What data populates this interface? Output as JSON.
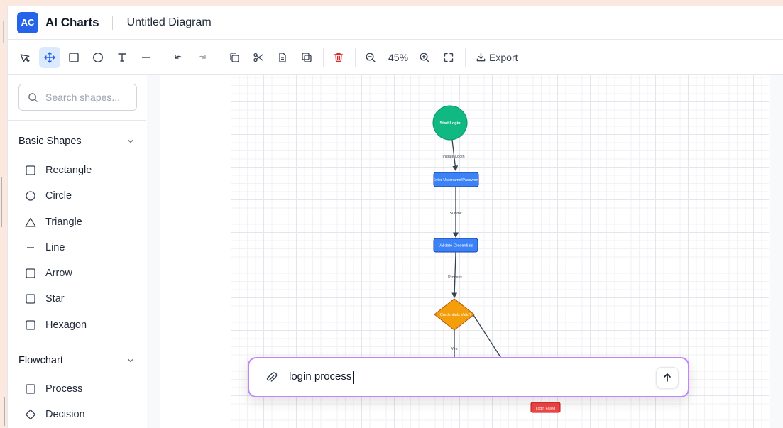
{
  "header": {
    "logo_text": "AC",
    "app_name": "AI Charts",
    "diagram_title": "Untitled Diagram"
  },
  "toolbar": {
    "tools": [
      "select-icon",
      "move-icon",
      "rectangle-icon",
      "circle-icon",
      "text-icon",
      "line-icon"
    ],
    "active_tool": "move",
    "zoom_level": "45%",
    "export_label": "Export"
  },
  "sidebar": {
    "search_placeholder": "Search shapes...",
    "sections": [
      {
        "title": "Basic Shapes",
        "items": [
          {
            "label": "Rectangle",
            "icon": "square-icon"
          },
          {
            "label": "Circle",
            "icon": "circle-icon"
          },
          {
            "label": "Triangle",
            "icon": "triangle-icon"
          },
          {
            "label": "Line",
            "icon": "line-icon"
          },
          {
            "label": "Arrow",
            "icon": "square-icon"
          },
          {
            "label": "Star",
            "icon": "square-icon"
          },
          {
            "label": "Hexagon",
            "icon": "square-icon"
          }
        ]
      },
      {
        "title": "Flowchart",
        "items": [
          {
            "label": "Process",
            "icon": "square-icon"
          },
          {
            "label": "Decision",
            "icon": "diamond-icon"
          }
        ]
      }
    ]
  },
  "diagram": {
    "nodes": {
      "start": "Start Login",
      "enter": "Enter Username/Password",
      "validate": "Validate Credentials",
      "decision": "Credentials Valid?",
      "failed": "Login Failed"
    },
    "edges": {
      "initiate": "Initiate Login",
      "submit": "Submit",
      "process": "Process",
      "yes": "Yes"
    },
    "colors": {
      "start": "#10b981",
      "process": "#3b82f6",
      "decision": "#f59e0b",
      "failed": "#ef4444"
    }
  },
  "prompt": {
    "value": "login process"
  }
}
